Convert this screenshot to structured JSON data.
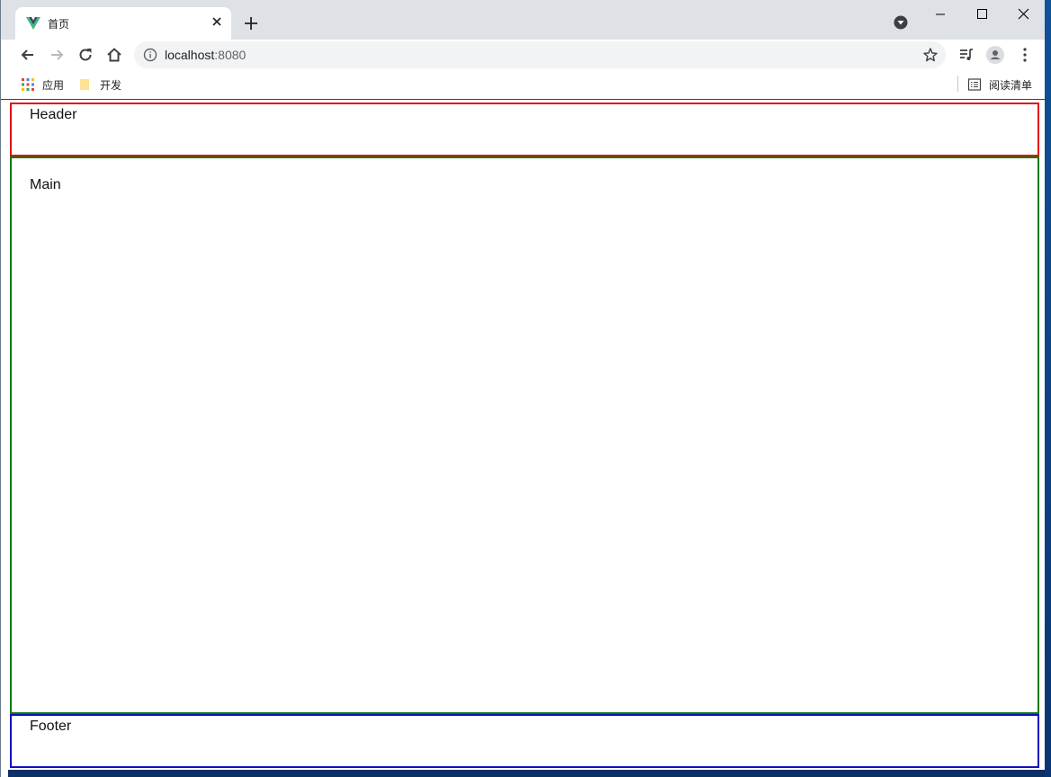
{
  "browser": {
    "tab": {
      "title": "首页",
      "favicon": "vue-logo-icon",
      "close_icon": "close-icon"
    },
    "new_tab_icon": "plus-icon",
    "tab_search_icon": "chevron-down-circle-icon",
    "window_controls": [
      "minimize-icon",
      "maximize-icon",
      "close-icon"
    ],
    "toolbar": {
      "back_icon": "arrow-left-icon",
      "forward_icon": "arrow-right-icon",
      "reload_icon": "reload-icon",
      "home_icon": "home-icon",
      "url_host": "localhost",
      "url_port": ":8080",
      "bookmark_star_icon": "star-icon",
      "media_icon": "playlist-icon",
      "profile_icon": "avatar-icon",
      "menu_icon": "kebab-menu-icon"
    },
    "bookmarks_bar": {
      "items": [
        {
          "label": "应用",
          "icon": "apps-grid-icon"
        },
        {
          "label": "开发",
          "icon": "folder-icon"
        }
      ],
      "reading_list": {
        "label": "阅读清单",
        "icon": "reading-list-icon"
      }
    }
  },
  "page": {
    "header_label": "Header",
    "main_label": "Main",
    "footer_label": "Footer"
  },
  "colors": {
    "header_border": "#e01010",
    "main_border": "#0a7a0a",
    "footer_border": "#1010c0"
  }
}
